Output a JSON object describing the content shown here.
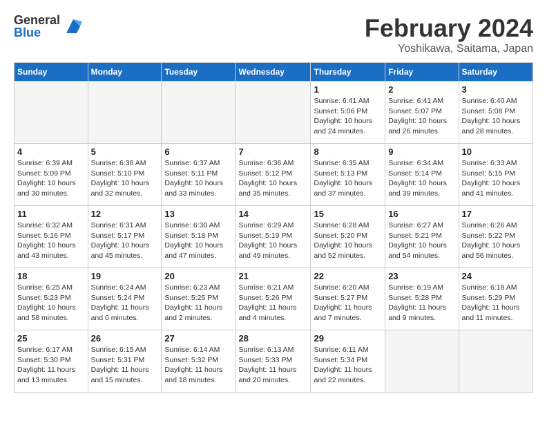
{
  "logo": {
    "general": "General",
    "blue": "Blue"
  },
  "title": {
    "month": "February 2024",
    "location": "Yoshikawa, Saitama, Japan"
  },
  "headers": [
    "Sunday",
    "Monday",
    "Tuesday",
    "Wednesday",
    "Thursday",
    "Friday",
    "Saturday"
  ],
  "weeks": [
    [
      {
        "day": "",
        "info": ""
      },
      {
        "day": "",
        "info": ""
      },
      {
        "day": "",
        "info": ""
      },
      {
        "day": "",
        "info": ""
      },
      {
        "day": "1",
        "info": "Sunrise: 6:41 AM\nSunset: 5:06 PM\nDaylight: 10 hours and 24 minutes."
      },
      {
        "day": "2",
        "info": "Sunrise: 6:41 AM\nSunset: 5:07 PM\nDaylight: 10 hours and 26 minutes."
      },
      {
        "day": "3",
        "info": "Sunrise: 6:40 AM\nSunset: 5:08 PM\nDaylight: 10 hours and 28 minutes."
      }
    ],
    [
      {
        "day": "4",
        "info": "Sunrise: 6:39 AM\nSunset: 5:09 PM\nDaylight: 10 hours and 30 minutes."
      },
      {
        "day": "5",
        "info": "Sunrise: 6:38 AM\nSunset: 5:10 PM\nDaylight: 10 hours and 32 minutes."
      },
      {
        "day": "6",
        "info": "Sunrise: 6:37 AM\nSunset: 5:11 PM\nDaylight: 10 hours and 33 minutes."
      },
      {
        "day": "7",
        "info": "Sunrise: 6:36 AM\nSunset: 5:12 PM\nDaylight: 10 hours and 35 minutes."
      },
      {
        "day": "8",
        "info": "Sunrise: 6:35 AM\nSunset: 5:13 PM\nDaylight: 10 hours and 37 minutes."
      },
      {
        "day": "9",
        "info": "Sunrise: 6:34 AM\nSunset: 5:14 PM\nDaylight: 10 hours and 39 minutes."
      },
      {
        "day": "10",
        "info": "Sunrise: 6:33 AM\nSunset: 5:15 PM\nDaylight: 10 hours and 41 minutes."
      }
    ],
    [
      {
        "day": "11",
        "info": "Sunrise: 6:32 AM\nSunset: 5:16 PM\nDaylight: 10 hours and 43 minutes."
      },
      {
        "day": "12",
        "info": "Sunrise: 6:31 AM\nSunset: 5:17 PM\nDaylight: 10 hours and 45 minutes."
      },
      {
        "day": "13",
        "info": "Sunrise: 6:30 AM\nSunset: 5:18 PM\nDaylight: 10 hours and 47 minutes."
      },
      {
        "day": "14",
        "info": "Sunrise: 6:29 AM\nSunset: 5:19 PM\nDaylight: 10 hours and 49 minutes."
      },
      {
        "day": "15",
        "info": "Sunrise: 6:28 AM\nSunset: 5:20 PM\nDaylight: 10 hours and 52 minutes."
      },
      {
        "day": "16",
        "info": "Sunrise: 6:27 AM\nSunset: 5:21 PM\nDaylight: 10 hours and 54 minutes."
      },
      {
        "day": "17",
        "info": "Sunrise: 6:26 AM\nSunset: 5:22 PM\nDaylight: 10 hours and 56 minutes."
      }
    ],
    [
      {
        "day": "18",
        "info": "Sunrise: 6:25 AM\nSunset: 5:23 PM\nDaylight: 10 hours and 58 minutes."
      },
      {
        "day": "19",
        "info": "Sunrise: 6:24 AM\nSunset: 5:24 PM\nDaylight: 11 hours and 0 minutes."
      },
      {
        "day": "20",
        "info": "Sunrise: 6:23 AM\nSunset: 5:25 PM\nDaylight: 11 hours and 2 minutes."
      },
      {
        "day": "21",
        "info": "Sunrise: 6:21 AM\nSunset: 5:26 PM\nDaylight: 11 hours and 4 minutes."
      },
      {
        "day": "22",
        "info": "Sunrise: 6:20 AM\nSunset: 5:27 PM\nDaylight: 11 hours and 7 minutes."
      },
      {
        "day": "23",
        "info": "Sunrise: 6:19 AM\nSunset: 5:28 PM\nDaylight: 11 hours and 9 minutes."
      },
      {
        "day": "24",
        "info": "Sunrise: 6:18 AM\nSunset: 5:29 PM\nDaylight: 11 hours and 11 minutes."
      }
    ],
    [
      {
        "day": "25",
        "info": "Sunrise: 6:17 AM\nSunset: 5:30 PM\nDaylight: 11 hours and 13 minutes."
      },
      {
        "day": "26",
        "info": "Sunrise: 6:15 AM\nSunset: 5:31 PM\nDaylight: 11 hours and 15 minutes."
      },
      {
        "day": "27",
        "info": "Sunrise: 6:14 AM\nSunset: 5:32 PM\nDaylight: 11 hours and 18 minutes."
      },
      {
        "day": "28",
        "info": "Sunrise: 6:13 AM\nSunset: 5:33 PM\nDaylight: 11 hours and 20 minutes."
      },
      {
        "day": "29",
        "info": "Sunrise: 6:11 AM\nSunset: 5:34 PM\nDaylight: 11 hours and 22 minutes."
      },
      {
        "day": "",
        "info": ""
      },
      {
        "day": "",
        "info": ""
      }
    ]
  ]
}
